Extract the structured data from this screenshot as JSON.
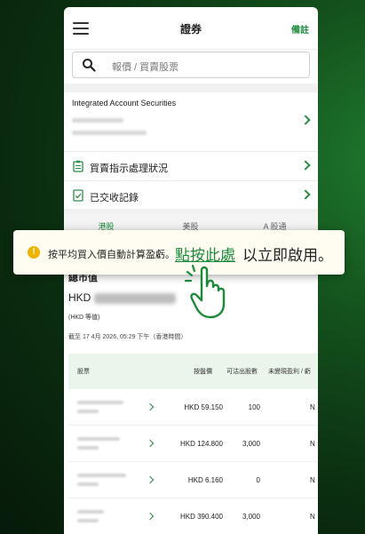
{
  "header": {
    "title": "證券",
    "notes_label": "備註"
  },
  "search": {
    "placeholder": "報價 / 買賣股票"
  },
  "account": {
    "title": "Integrated Account Securities"
  },
  "menu": {
    "items": [
      {
        "label": "買賣指示處理狀況",
        "icon": "clipboard-icon"
      },
      {
        "label": "已交收記錄",
        "icon": "receipt-check-icon"
      }
    ]
  },
  "tabs": [
    {
      "label": "港股",
      "active": true
    },
    {
      "label": "美股",
      "active": false
    },
    {
      "label": "A 股通",
      "active": false
    }
  ],
  "portfolio": {
    "total_label": "總市值",
    "currency": "HKD",
    "equiv_note": "(HKD 等值)",
    "as_of": "截至 17 4月 2026, 05:29 下午（香港時間）"
  },
  "table": {
    "headers": [
      "股票",
      "按盤價",
      "可沽出股數",
      "未變現盈利 / 虧"
    ],
    "rows": [
      {
        "price": "HKD 59.150",
        "quantity": "100",
        "unrealized": "N"
      },
      {
        "price": "HKD 124.800",
        "quantity": "3,000",
        "unrealized": "N"
      },
      {
        "price": "HKD 6.160",
        "quantity": "0",
        "unrealized": "N"
      },
      {
        "price": "HKD 390.400",
        "quantity": "3,000",
        "unrealized": "N"
      }
    ]
  },
  "toast": {
    "message": "按平均買入價自動計算盈虧。",
    "link_label": "點按此處",
    "tail": "以立即啟用。",
    "warning_glyph": "!"
  },
  "colors": {
    "brand_green": "#1a8a3a",
    "warning": "#f0b400"
  }
}
